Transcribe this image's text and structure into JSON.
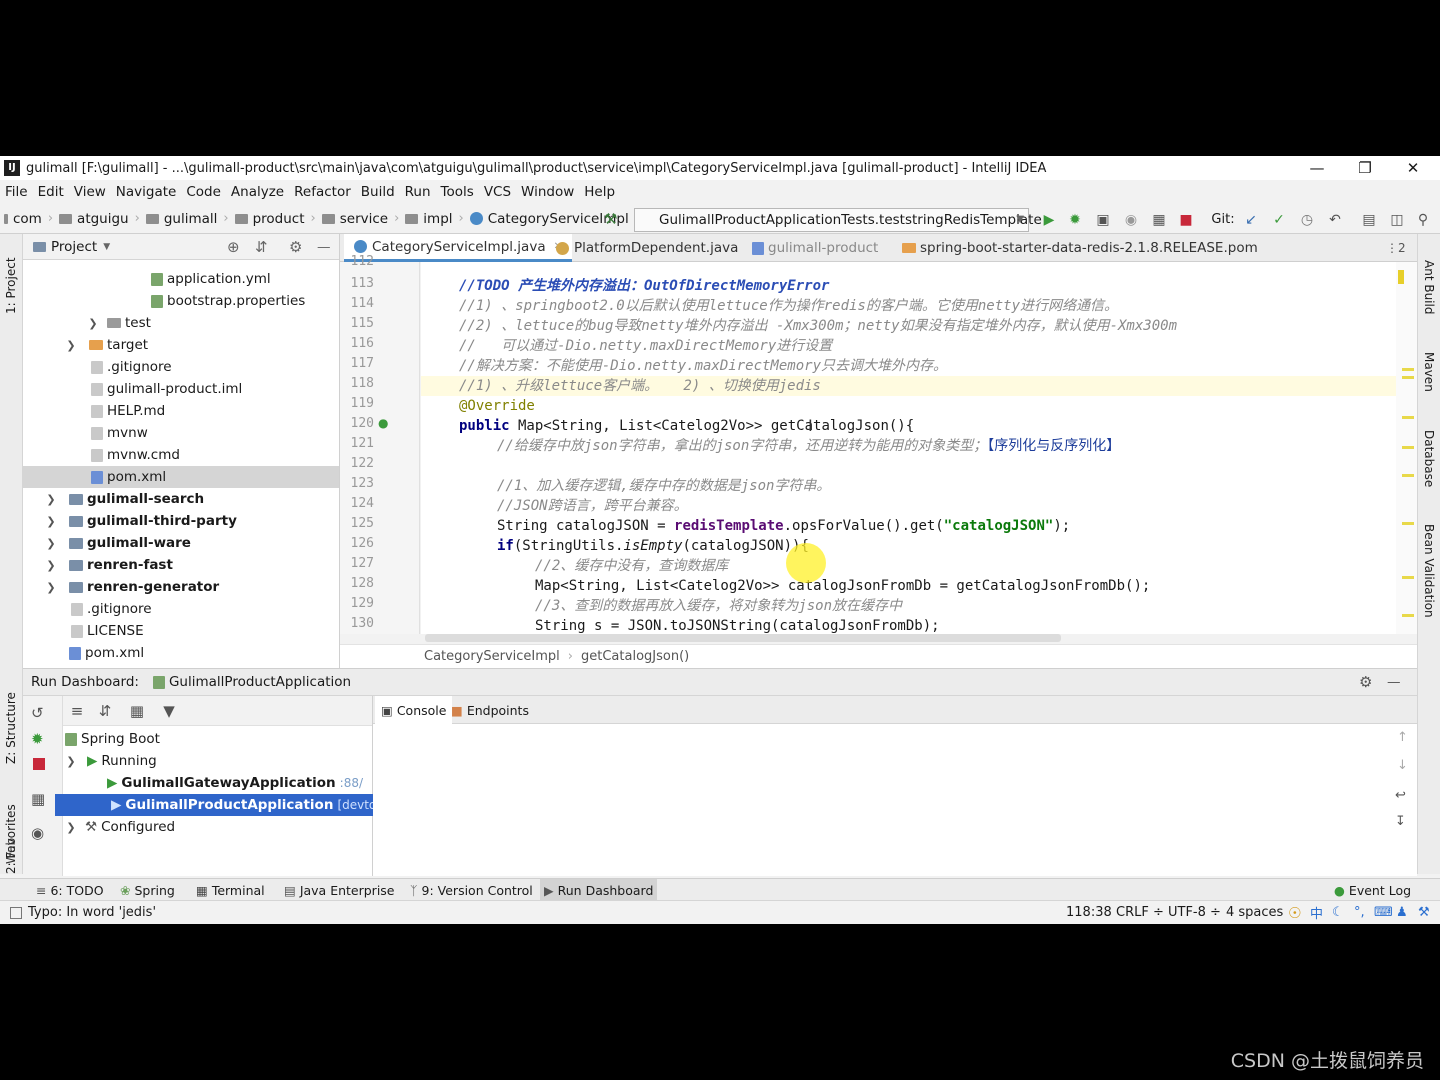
{
  "window": {
    "title": "gulimall [F:\\gulimall] - ...\\gulimall-product\\src\\main\\java\\com\\atguigu\\gulimall\\product\\service\\impl\\CategoryServiceImpl.java [gulimall-product] - IntelliJ IDEA",
    "app_icon_label": "IJ"
  },
  "menu": [
    "File",
    "Edit",
    "View",
    "Navigate",
    "Code",
    "Analyze",
    "Refactor",
    "Build",
    "Run",
    "Tools",
    "VCS",
    "Window",
    "Help"
  ],
  "breadcrumb": [
    "com",
    "atguigu",
    "gulimall",
    "product",
    "service",
    "impl",
    "CategoryServiceImpl"
  ],
  "run_config": "GulimallProductApplicationTests.teststringRedisTemplate",
  "git_label": "Git:",
  "left_stripe": {
    "project": "1: Project",
    "structure": "Z: Structure",
    "favorites": "2: Favorites",
    "web": "Web"
  },
  "right_stripe": {
    "ant": "Ant Build",
    "maven": "Maven",
    "database": "Database",
    "bean": "Bean Validation"
  },
  "project_panel": {
    "title": "Project",
    "items": [
      {
        "label": "application.yml",
        "icon": "yml"
      },
      {
        "label": "bootstrap.properties",
        "icon": "yml"
      },
      {
        "label": "test",
        "icon": "folder"
      },
      {
        "label": "target",
        "icon": "target"
      },
      {
        "label": ".gitignore",
        "icon": "file"
      },
      {
        "label": "gulimall-product.iml",
        "icon": "file"
      },
      {
        "label": "HELP.md",
        "icon": "file"
      },
      {
        "label": "mvnw",
        "icon": "file"
      },
      {
        "label": "mvnw.cmd",
        "icon": "file"
      },
      {
        "label": "pom.xml",
        "icon": "xml"
      },
      {
        "label": "gulimall-search",
        "icon": "module"
      },
      {
        "label": "gulimall-third-party",
        "icon": "module"
      },
      {
        "label": "gulimall-ware",
        "icon": "module"
      },
      {
        "label": "renren-fast",
        "icon": "module"
      },
      {
        "label": "renren-generator",
        "icon": "module"
      },
      {
        "label": ".gitignore",
        "icon": "file"
      },
      {
        "label": "LICENSE",
        "icon": "file"
      },
      {
        "label": "pom.xml",
        "icon": "xml"
      }
    ]
  },
  "editor": {
    "tabs": [
      "CategoryServiceImpl.java",
      "PlatformDependent.java",
      "gulimall-product",
      "spring-boot-starter-data-redis-2.1.8.RELEASE.pom"
    ],
    "tab_overflow": "⋮2",
    "line_numbers": [
      "112",
      "113",
      "114",
      "115",
      "116",
      "117",
      "118",
      "119",
      "120",
      "121",
      "122",
      "123",
      "124",
      "125",
      "126",
      "127",
      "128",
      "129",
      "130"
    ],
    "lines": {
      "l113_todo": "//TODO 产生堆外内存溢出：OutOfDirectMemoryError",
      "l114": "//1) 、springboot2.0以后默认使用lettuce作为操作redis的客户端。它使用netty进行网络通信。",
      "l115": "//2) 、lettuce的bug导致netty堆外内存溢出 -Xmx300m；netty如果没有指定堆外内存，默认使用-Xmx300m",
      "l116": "//   可以通过-Dio.netty.maxDirectMemory进行设置",
      "l117": "//解决方案：不能使用-Dio.netty.maxDirectMemory只去调大堆外内存。",
      "l118": "//1) 、升级lettuce客户端。   2) 、切换使用jedis",
      "l119": "@Override",
      "l120_kw": "public",
      "l120_rest": " Map<String, List<Catelog2Vo>> getCatalogJson(){",
      "l121_cmt": "//给缓存中放json字符串，拿出的json字符串，还用逆转为能用的对象类型；",
      "l121_brk": "【序列化与反序列化】",
      "l123": "//1、加入缓存逻辑,缓存中存的数据是json字符串。",
      "l124": "//JSON跨语言，跨平台兼容。",
      "l125_a": "String catalogJSON = ",
      "l125_fld": "redisTemplate",
      "l125_b": ".opsForValue().get(",
      "l125_str": "\"catalogJSON\"",
      "l125_c": ");",
      "l126_kw": "if",
      "l126_a": "(StringUtils.",
      "l126_it": "isEmpty",
      "l126_b": "(catalogJSON)){",
      "l127": "//2、缓存中没有，查询数据库",
      "l128": "Map<String, List<Catelog2Vo>> catalogJsonFromDb = getCatalogJsonFromDb();",
      "l129": "//3、查到的数据再放入缓存，将对象转为json放在缓存中",
      "l130": "String s = JSON.toJSONString(catalogJsonFromDb);"
    },
    "footer_crumbs": [
      "CategoryServiceImpl",
      "getCatalogJson()"
    ]
  },
  "run_dashboard": {
    "label": "Run Dashboard:",
    "app": "GulimallProductApplication",
    "items": [
      {
        "label": "Spring Boot",
        "suffix": ""
      },
      {
        "label": "Running",
        "suffix": ""
      },
      {
        "label": "GulimallGatewayApplication",
        "suffix": ":88/"
      },
      {
        "label": "GulimallProductApplication",
        "suffix": "[devtools]"
      },
      {
        "label": "Configured",
        "suffix": ""
      }
    ],
    "console_tabs": [
      "Console",
      "Endpoints"
    ]
  },
  "tool_windows": [
    {
      "label": "6: TODO"
    },
    {
      "label": "Spring"
    },
    {
      "label": "Terminal"
    },
    {
      "label": "Java Enterprise"
    },
    {
      "label": "9: Version Control"
    },
    {
      "label": "Run Dashboard"
    }
  ],
  "event_log": "Event Log",
  "status": {
    "message": "Typo: In word 'jedis'",
    "position": "118:38",
    "line_sep": "CRLF ÷",
    "encoding": "UTF-8 ÷",
    "indent": "4 spaces",
    "ime": "中"
  },
  "watermark": "CSDN @土拨鼠饲养员"
}
